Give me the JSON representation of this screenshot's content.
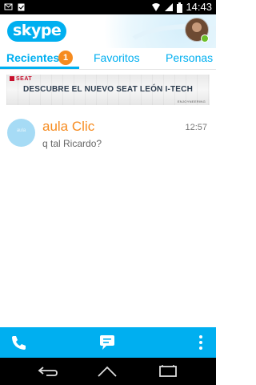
{
  "status_bar": {
    "time": "14:43",
    "left_icons": [
      "mail-icon",
      "clipboard-check-icon"
    ],
    "right_icons": [
      "wifi-icon",
      "signal-icon",
      "battery-icon"
    ]
  },
  "header": {
    "logo_text": "skype",
    "avatar_icon": "profile-avatar",
    "presence_color": "#6cbf2a"
  },
  "tabs": [
    {
      "label": "Recientes",
      "badge": "1",
      "active": true
    },
    {
      "label": "Favoritos",
      "active": false
    },
    {
      "label": "Personas",
      "active": false
    }
  ],
  "ad": {
    "brand": "SEAT",
    "headline": "DESCUBRE EL NUEVO SEAT LEÓN I-TECH",
    "tagline": "ENJOYNEERING"
  },
  "conversations": [
    {
      "name": "aula Clic",
      "message": "q tal Ricardo?",
      "time": "12:57",
      "avatar_text": "aula"
    }
  ],
  "action_bar": {
    "icons": [
      "phone-icon",
      "chat-bubble-icon",
      "overflow-menu-icon"
    ]
  },
  "nav_bar": {
    "icons": [
      "back-icon",
      "home-icon",
      "recents-icon"
    ]
  },
  "colors": {
    "accent": "#00aff0",
    "badge": "#f68b1f",
    "name": "#f68b1f"
  }
}
